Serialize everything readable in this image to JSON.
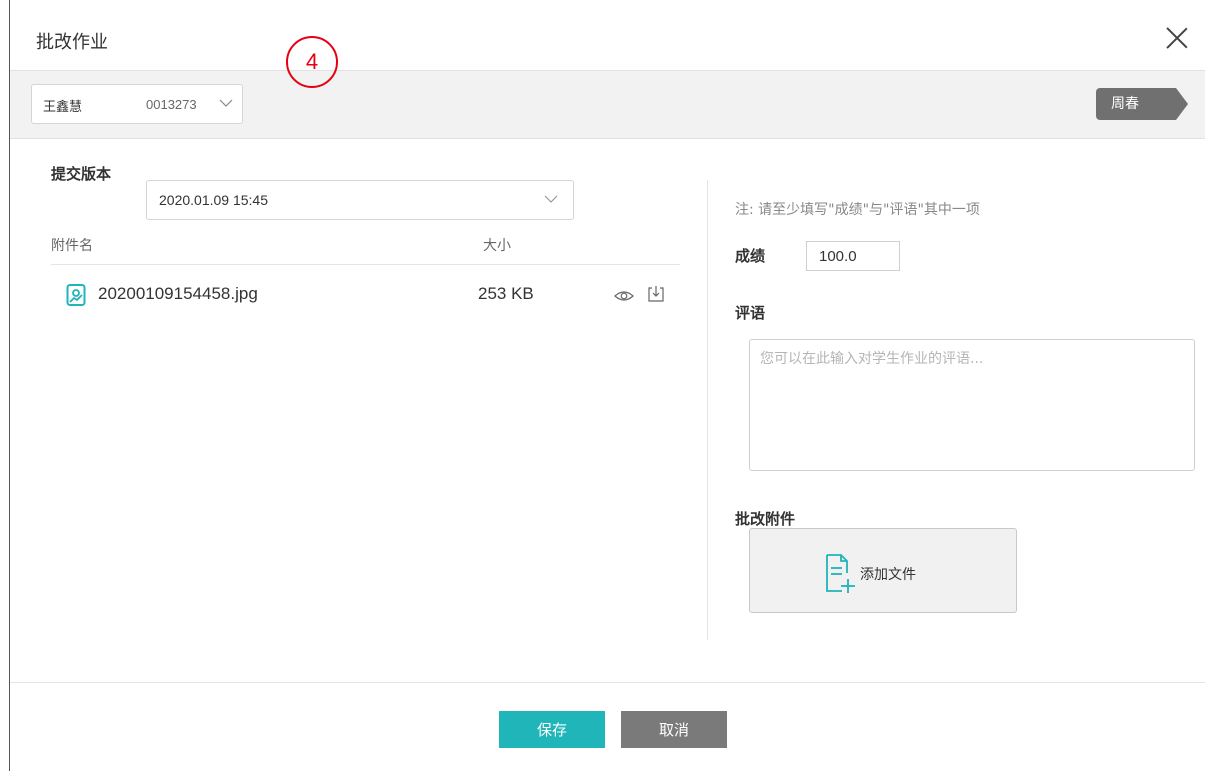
{
  "dialog": {
    "title": "批改作业",
    "step_marker": "4"
  },
  "student_bar": {
    "student_name": "王鑫慧",
    "student_id": "0013273",
    "teacher_tag": "周春"
  },
  "submission": {
    "version_label": "提交版本",
    "version_value": "2020.01.09 15:45",
    "columns": {
      "name": "附件名",
      "size": "大小"
    },
    "files": [
      {
        "name": "20200109154458.jpg",
        "size": "253 KB"
      }
    ]
  },
  "grading": {
    "note": "注: 请至少填写\"成绩\"与\"评语\"其中一项",
    "score_label": "成绩",
    "score_value": "100.0",
    "comment_label": "评语",
    "comment_placeholder": "您可以在此输入对学生作业的评语...",
    "attachment_label": "批改附件",
    "add_file_label": "添加文件"
  },
  "footer": {
    "save_label": "保存",
    "cancel_label": "取消"
  },
  "colors": {
    "accent": "#1fb5b9",
    "cancel": "#7a7a7a",
    "step_marker": "#e60012",
    "teacher_tag": "#707070"
  },
  "icons": {
    "close": "close-icon",
    "chevron": "chevron-down-icon",
    "file": "image-file-icon",
    "preview": "eye-icon",
    "download": "download-icon",
    "add_file": "add-file-icon"
  }
}
